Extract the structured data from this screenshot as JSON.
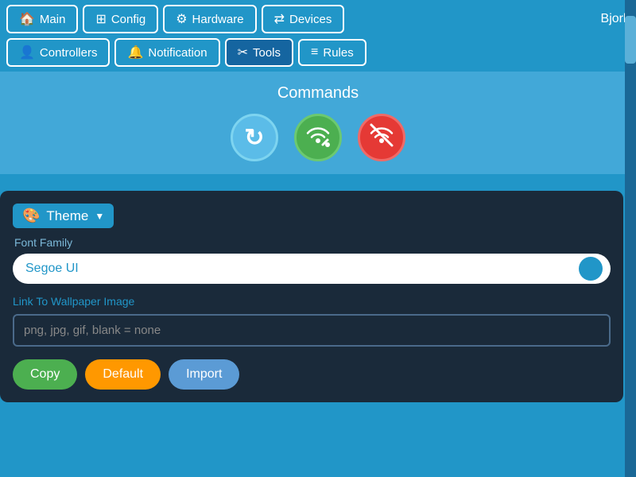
{
  "nav": {
    "tabs_row1": [
      {
        "id": "main",
        "label": "Main",
        "icon": "🏠",
        "active": false
      },
      {
        "id": "config",
        "label": "Config",
        "icon": "⊞",
        "active": false
      },
      {
        "id": "hardware",
        "label": "Hardware",
        "icon": "⚙",
        "active": false
      },
      {
        "id": "devices",
        "label": "Devices",
        "icon": "⇄",
        "active": false
      }
    ],
    "user_label": "Bjork",
    "tabs_row2": [
      {
        "id": "controllers",
        "label": "Controllers",
        "icon": "👤",
        "active": false
      },
      {
        "id": "notification",
        "label": "Notification",
        "icon": "🔔",
        "active": false
      },
      {
        "id": "tools",
        "label": "Tools",
        "icon": "✂",
        "active": true
      },
      {
        "id": "rules",
        "label": "Rules",
        "icon": "≡",
        "active": false
      }
    ]
  },
  "commands": {
    "title": "Commands",
    "icons": [
      {
        "id": "reload",
        "symbol": "↻",
        "type": "reload"
      },
      {
        "id": "wifi-on",
        "symbol": "((•))",
        "type": "wifi-on"
      },
      {
        "id": "wifi-off",
        "symbol": "((×))",
        "type": "wifi-off"
      }
    ]
  },
  "theme_panel": {
    "header_label": "Theme",
    "font_family_label": "Font Family",
    "font_family_value": "Segoe UI",
    "wallpaper_label": "Link To Wallpaper Image",
    "wallpaper_placeholder": "png, jpg, gif, blank = none",
    "buttons": {
      "copy": "Copy",
      "default": "Default",
      "import": "Import"
    }
  }
}
